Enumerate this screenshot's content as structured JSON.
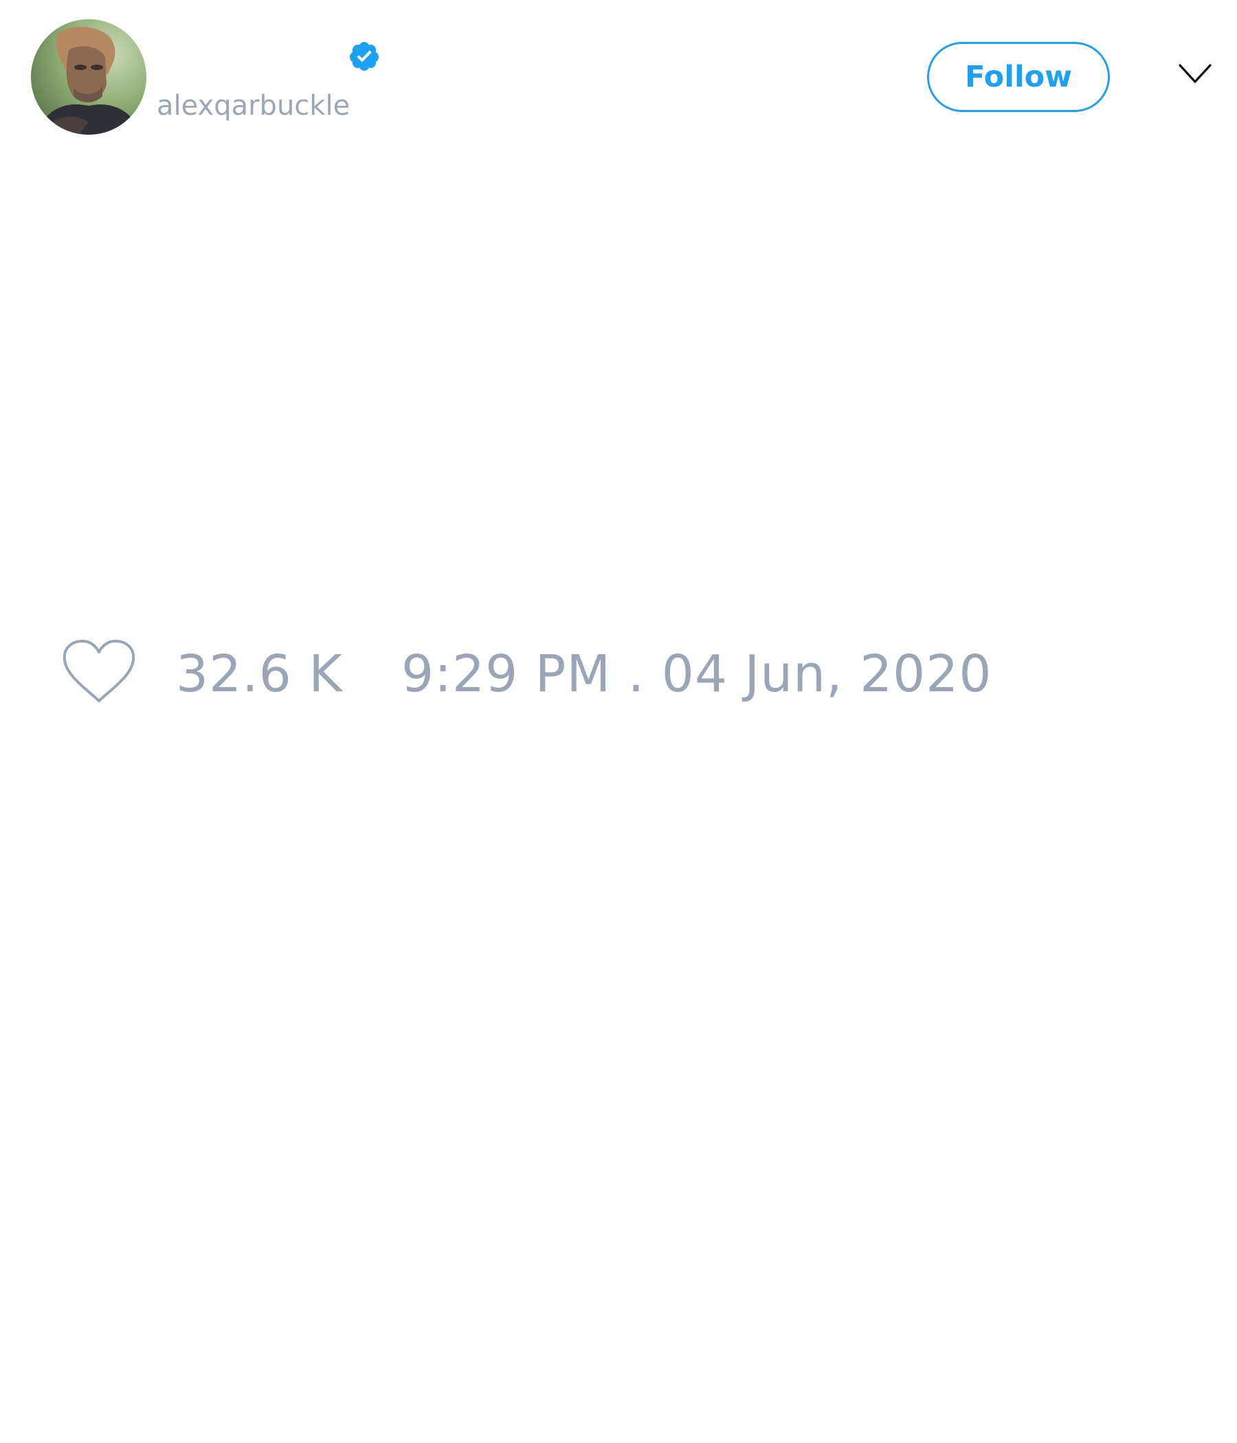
{
  "author": {
    "handle": "alexqarbuckle",
    "verified": true,
    "avatar": "profile-photo"
  },
  "header": {
    "follow_label": "Follow",
    "menu_icon": "chevron-down-icon"
  },
  "stats": {
    "like_icon": "heart-outline-icon",
    "likes": "32.6 K",
    "timestamp": "9:29 PM . 04 Jun, 2020"
  },
  "colors": {
    "accent": "#1da1f2",
    "muted_text": "#98a6b8",
    "background": "#ffffff"
  }
}
